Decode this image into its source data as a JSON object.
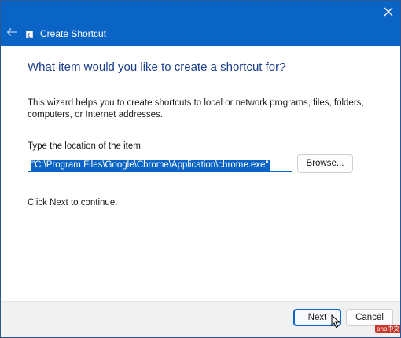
{
  "window": {
    "title": "Create Shortcut",
    "accent_color": "#0a64c6",
    "heading_color": "#1a3e8c"
  },
  "titlebar": {
    "back_icon": "back-arrow-icon",
    "close_icon": "close-icon",
    "app_icon": "shortcut-wizard-icon"
  },
  "main": {
    "heading": "What item would you like to create a shortcut for?",
    "description": "This wizard helps you to create shortcuts to local or network programs, files, folders, computers, or Internet addresses.",
    "location_label": "Type the location of the item:",
    "location_value": "\"C:\\Program Files\\Google\\Chrome\\Application\\chrome.exe\"",
    "browse_label": "Browse...",
    "hint": "Click Next to continue."
  },
  "footer": {
    "next_label": "Next",
    "cancel_label": "Cancel",
    "cursor_icon": "mouse-pointer-icon"
  },
  "watermark": {
    "text": "php中文网"
  }
}
